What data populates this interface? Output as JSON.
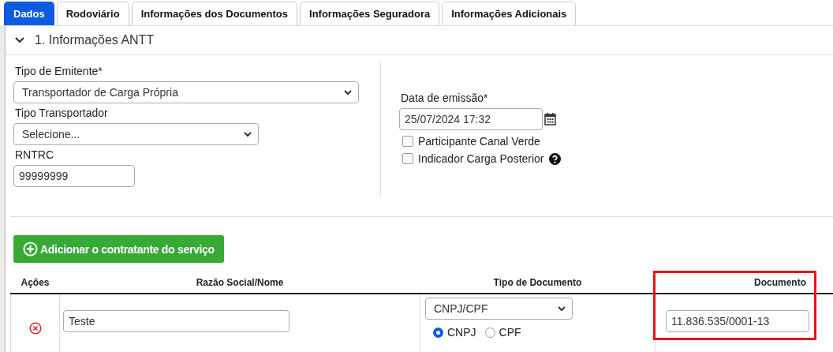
{
  "tabs": [
    {
      "label": "Dados",
      "selected": true
    },
    {
      "label": "Rodoviário",
      "selected": false
    },
    {
      "label": "Informações dos Documentos",
      "selected": false
    },
    {
      "label": "Informações Seguradora",
      "selected": false
    },
    {
      "label": "Informações Adicionais",
      "selected": false
    }
  ],
  "section": {
    "title": "1. Informações ANTT",
    "expanded": true
  },
  "left_fields": [
    {
      "kind": "select",
      "label": "Tipo de Emitente*",
      "value": "Transportador de Carga Própria"
    },
    {
      "kind": "select",
      "label": "Tipo Transportador",
      "value": "Selecione..."
    },
    {
      "kind": "text",
      "label": "RNTRC",
      "value": "99999999"
    }
  ],
  "date_field": {
    "label": "Data de emissão*",
    "value": "25/07/2024 17:32"
  },
  "checkboxes": [
    {
      "label": "Participante Canal Verde",
      "checked": false,
      "help": false
    },
    {
      "label": "Indicador Carga Posterior",
      "checked": false,
      "help": true
    }
  ],
  "add_button": {
    "label": "Adicionar o contratante do serviço"
  },
  "table": {
    "columns": [
      {
        "label": "Ações",
        "highlighted": false
      },
      {
        "label": "Razão Social/Nome",
        "highlighted": false
      },
      {
        "label": "Tipo de Documento",
        "highlighted": false
      },
      {
        "label": "Documento",
        "highlighted": true
      }
    ],
    "rows": [
      {
        "name": "Teste",
        "doc_type": "CNPJ/CPF",
        "radios": [
          {
            "label": "CNPJ",
            "selected": true
          },
          {
            "label": "CPF",
            "selected": false
          }
        ],
        "document": "11.836.535/0001-13"
      }
    ]
  }
}
